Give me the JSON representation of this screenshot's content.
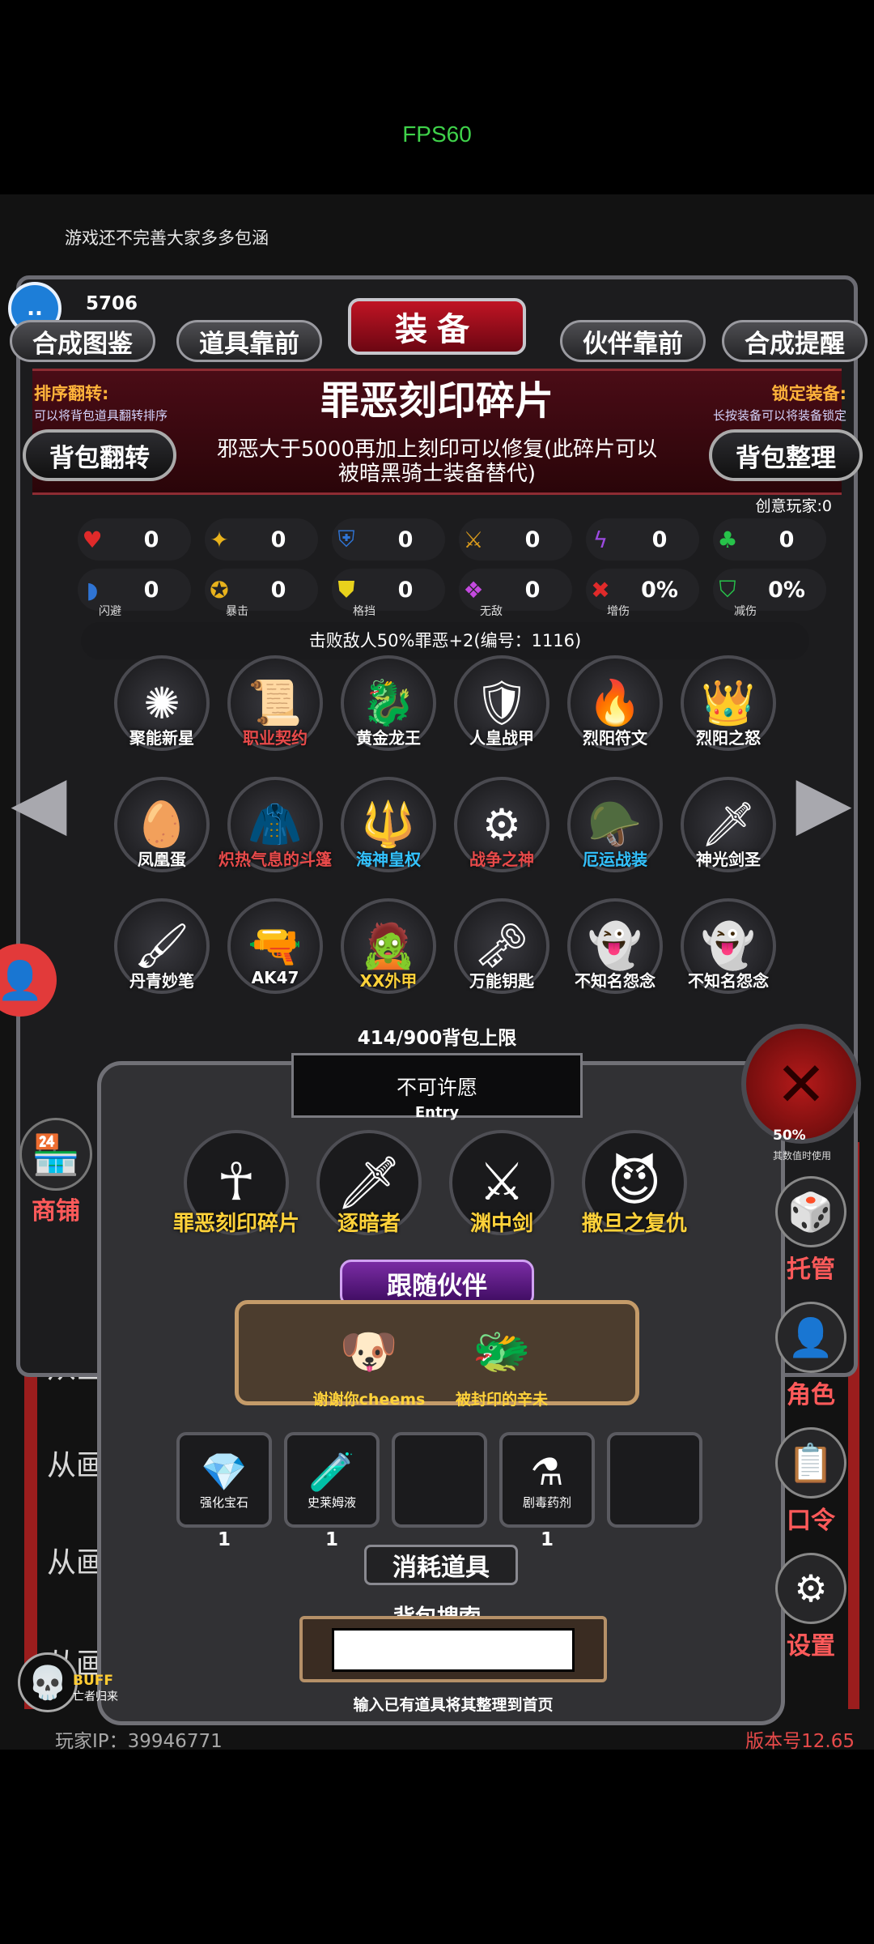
{
  "status": {
    "fps": "FPS60"
  },
  "notice": "游戏还不完善大家多多包涵",
  "player": {
    "score": "5706",
    "avatar_glyph": "..",
    "ip_label": "玩家IP：39946771",
    "version": "版本号12.65"
  },
  "tabs": {
    "left1": "合成图鉴",
    "left2": "道具靠前",
    "title": "装备",
    "right1": "伙伴靠前",
    "right2": "合成提醒"
  },
  "sort": {
    "title": "排序翻转:",
    "desc": "可以将背包道具翻转排序"
  },
  "lock": {
    "title": "锁定装备:",
    "desc": "长按装备可以将装备锁定"
  },
  "item": {
    "name": "罪恶刻印碎片",
    "desc": "邪恶大于5000再加上刻印可以修复(此碎片可以被暗黑骑士装备替代)"
  },
  "buttons": {
    "flip": "背包翻转",
    "tidy": "背包整理"
  },
  "creative": "创意玩家:0",
  "stats_row1": [
    {
      "icon": "heart-icon",
      "glyph": "♥",
      "color": "#e02a2a",
      "value": "0"
    },
    {
      "icon": "strength-icon",
      "glyph": "✦",
      "color": "#e8b21c",
      "value": "0"
    },
    {
      "icon": "armor-icon",
      "glyph": "⛨",
      "color": "#2f74d4",
      "value": "0"
    },
    {
      "icon": "sword-icon",
      "glyph": "⚔",
      "color": "#d89a1c",
      "value": "0"
    },
    {
      "icon": "lightning-icon",
      "glyph": "ϟ",
      "color": "#9c4ae0",
      "value": "0"
    },
    {
      "icon": "clover-icon",
      "glyph": "♣",
      "color": "#27c24a",
      "value": "0"
    }
  ],
  "stats_row2": [
    {
      "icon": "dodge-icon",
      "glyph": "◗",
      "color": "#2f74d4",
      "value": "0",
      "label": "闪避"
    },
    {
      "icon": "crit-icon",
      "glyph": "✪",
      "color": "#e8b21c",
      "value": "0",
      "label": "暴击"
    },
    {
      "icon": "block-icon",
      "glyph": "⛊",
      "color": "#e8d21c",
      "value": "0",
      "label": "格挡"
    },
    {
      "icon": "invincible-icon",
      "glyph": "❖",
      "color": "#c44ae0",
      "value": "0",
      "label": "无敌"
    },
    {
      "icon": "damage-up-icon",
      "glyph": "✖",
      "color": "#e02a2a",
      "value": "0%",
      "label": "增伤"
    },
    {
      "icon": "damage-reduce-icon",
      "glyph": "⛉",
      "color": "#27c24a",
      "value": "0%",
      "label": "减伤"
    }
  ],
  "kill_bonus": "击败敌人50%罪恶+2(编号：1116)",
  "inventory": [
    {
      "label": "聚能新星",
      "glyph": "✺",
      "label_color": "#ffffff"
    },
    {
      "label": "职业契约",
      "glyph": "📜",
      "label_color": "#e84a4a"
    },
    {
      "label": "黄金龙王",
      "glyph": "🐉",
      "label_color": "#ffffff"
    },
    {
      "label": "人皇战甲",
      "glyph": "🛡",
      "label_color": "#ffffff"
    },
    {
      "label": "烈阳符文",
      "glyph": "🔥",
      "label_color": "#ffffff"
    },
    {
      "label": "烈阳之怒",
      "glyph": "👑",
      "label_color": "#ffffff"
    },
    {
      "label": "凤凰蛋",
      "glyph": "🥚",
      "label_color": "#ffffff"
    },
    {
      "label": "炽热气息的斗篷",
      "glyph": "🧥",
      "label_color": "#e84a4a"
    },
    {
      "label": "海神皇权",
      "glyph": "🔱",
      "label_color": "#33c3ff"
    },
    {
      "label": "战争之神",
      "glyph": "⚙",
      "label_color": "#e84a4a"
    },
    {
      "label": "厄运战装",
      "glyph": "🪖",
      "label_color": "#33c3ff"
    },
    {
      "label": "神光剑圣",
      "glyph": "🗡",
      "label_color": "#ffffff"
    },
    {
      "label": "丹青妙笔",
      "glyph": "🖌",
      "label_color": "#ffffff"
    },
    {
      "label": "AK47",
      "glyph": "🔫",
      "label_color": "#ffffff"
    },
    {
      "label": "XX外甲",
      "glyph": "🧟",
      "label_color": "#ffd23a"
    },
    {
      "label": "万能钥匙",
      "glyph": "🗝",
      "label_color": "#ffffff"
    },
    {
      "label": "不知名怨念",
      "glyph": "👻",
      "label_color": "#ffffff"
    },
    {
      "label": "不知名怨念",
      "glyph": "👻",
      "label_color": "#ffffff"
    }
  ],
  "capacity": "414/900背包上限",
  "wish": {
    "text": "不可许愿",
    "entry": "Entry"
  },
  "equipped": [
    {
      "label": "罪恶刻印碎片",
      "glyph": "☥"
    },
    {
      "label": "逐暗者",
      "glyph": "🗡"
    },
    {
      "label": "渊中剑",
      "glyph": "⚔"
    },
    {
      "label": "撒旦之复仇",
      "glyph": "😈"
    }
  ],
  "companion": {
    "title": "跟随伙伴",
    "items": [
      {
        "label": "谢谢你cheems",
        "glyph": "🐶"
      },
      {
        "label": "被封印的辛未",
        "glyph": "🐲"
      }
    ]
  },
  "consumables": [
    {
      "name": "强化宝石",
      "glyph": "💎",
      "qty": "1"
    },
    {
      "name": "史莱姆液",
      "glyph": "🧪",
      "qty": "1"
    },
    {
      "name": "",
      "glyph": "",
      "qty": ""
    },
    {
      "name": "剧毒药剂",
      "glyph": "⚗",
      "qty": "1"
    },
    {
      "name": "",
      "glyph": "",
      "qty": ""
    }
  ],
  "consumables_title": "消耗道具",
  "search": {
    "title": "背包搜索",
    "value": "",
    "hint": "输入已有道具将其整理到首页"
  },
  "right_menu": [
    {
      "label": "托管",
      "glyph": "🎲",
      "icon": "dice-icon"
    },
    {
      "label": "角色",
      "glyph": "👤",
      "icon": "character-icon"
    },
    {
      "label": "口令",
      "glyph": "📋",
      "icon": "code-icon"
    },
    {
      "label": "设置",
      "glyph": "⚙",
      "icon": "gear-icon"
    }
  ],
  "right_percent": {
    "value": "50%",
    "sub": "其数值时使用"
  },
  "shop": {
    "label": "商铺",
    "glyph": "🏪"
  },
  "log_lines": [
    "从画",
    "从画里",
    "从画",
    "从画",
    "从画里取出了美味"
  ],
  "buff": {
    "title": "BUFF",
    "sub": "亡者归来",
    "glyph": "💀"
  },
  "close_glyph": "✕"
}
